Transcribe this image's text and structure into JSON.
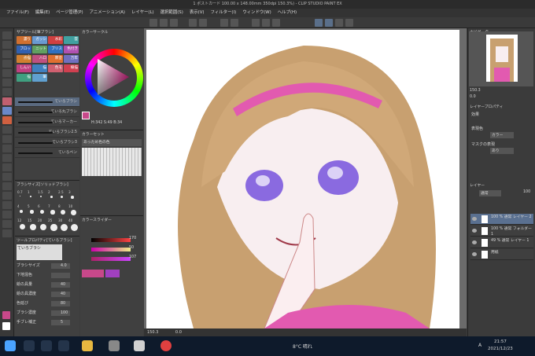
{
  "window": {
    "title": "1 ポストカード 100.00 x 148.00mm 350dpi 150.3%) - CLIP STUDIO PAINT EX"
  },
  "menu": [
    "ファイル(F)",
    "編集(E)",
    "ページ管理(P)",
    "アニメーション(A)",
    "レイヤー(L)",
    "選択範囲(S)",
    "表示(V)",
    "フィルター(I)",
    "ウィンドウ(W)",
    "ヘルプ(H)"
  ],
  "subtool": {
    "title": "サブツール[筆ブラシ]",
    "tabs": [
      "濃り",
      "ガッシュ",
      "水彩",
      "雲",
      "ブロック",
      "ニット",
      "ブリス",
      "色付き",
      "点描",
      "ハロ",
      "厚塗",
      "万年",
      "しんい",
      "描",
      "色モ",
      "線描",
      "描",
      "筆"
    ],
    "brushes": [
      "ていろブラシ",
      "ていろ丸ブラシ",
      "ていろマーカー",
      "ていろブラシ2.5",
      "ていろブラシ3",
      "ていろペン"
    ]
  },
  "brushsize": {
    "title": "ブラシサイズ[ソリッドブラシ]",
    "values": [
      "0.7",
      "1",
      "1.5",
      "2",
      "2.5",
      "3",
      "4",
      "5",
      "6",
      "7",
      "8",
      "10",
      "12",
      "15",
      "20",
      "25",
      "30",
      "40"
    ]
  },
  "toolprop": {
    "title": "ツールプロパティ[ていろブラシ]",
    "name": "ていろブラシ",
    "rows": [
      {
        "label": "ブラシサイズ",
        "value": "4.0"
      },
      {
        "label": "下地混色",
        "value": ""
      },
      {
        "label": "絵の具量",
        "value": "40"
      },
      {
        "label": "絵の具濃度",
        "value": "40"
      },
      {
        "label": "色延び",
        "value": "80"
      },
      {
        "label": "ブラシ濃度",
        "value": "100"
      },
      {
        "label": "手ブレ補正",
        "value": "5"
      }
    ]
  },
  "color": {
    "title": "カラーサークル",
    "hsv": "H:342 S:49 B:34",
    "current": "#c8488a"
  },
  "swatch": {
    "title": "カラーセット",
    "set": "あっため色の色"
  },
  "slider": {
    "title": "カラースライダー",
    "r": "170",
    "g": "50",
    "b": "107"
  },
  "navigator": {
    "title": "ナビゲーター",
    "zoom": "150.3",
    "angle": "0.0"
  },
  "layerprop": {
    "title": "レイヤープロパティ",
    "effect": "効果",
    "expr": "表現色",
    "exprval": "カラー",
    "mask": "マスクの表現",
    "maskval": "あり"
  },
  "layers": {
    "title": "レイヤー",
    "mode": "通常",
    "opacity": "100",
    "items": [
      {
        "name": "100 % 通常 レイヤー 2",
        "active": true
      },
      {
        "name": "100 % 通常 フォルダー 1",
        "active": false
      },
      {
        "name": "49 % 通常 レイヤー 1",
        "active": false
      },
      {
        "name": "用紙",
        "active": false
      }
    ]
  },
  "status": {
    "zoom": "150.3",
    "angle": "0.0"
  },
  "taskbar": {
    "weather": "8°C 晴れ",
    "time": "21:57",
    "date": "2021/12/23",
    "ime": "A"
  }
}
